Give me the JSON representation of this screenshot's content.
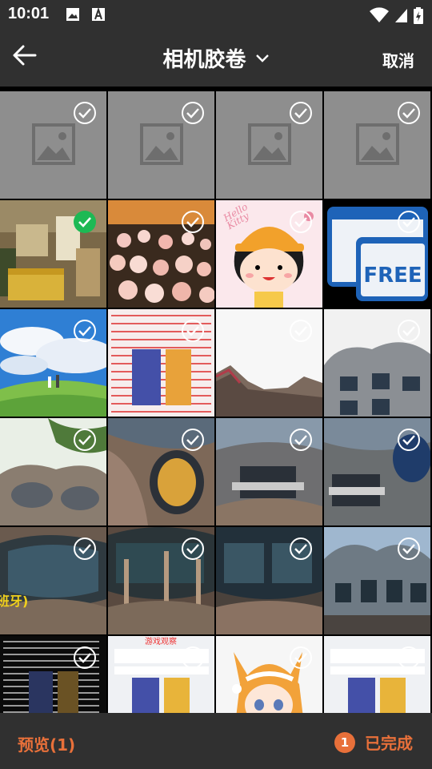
{
  "status": {
    "time": "10:01"
  },
  "toolbar": {
    "title": "相机胶卷",
    "cancel": "取消"
  },
  "grid": {
    "selected_index": 4,
    "watermark_text": "游戏观察",
    "bottom_caption": "游戏观察",
    "spanish_caption": "班牙)",
    "free_label": "FREE",
    "hello_kitty": "Hello Kitty"
  },
  "bottom": {
    "preview": "预览(1)",
    "count": "1",
    "done": "已完成"
  },
  "colors": {
    "accent": "#e8703a",
    "bar": "#303030",
    "selected": "#1db954"
  }
}
